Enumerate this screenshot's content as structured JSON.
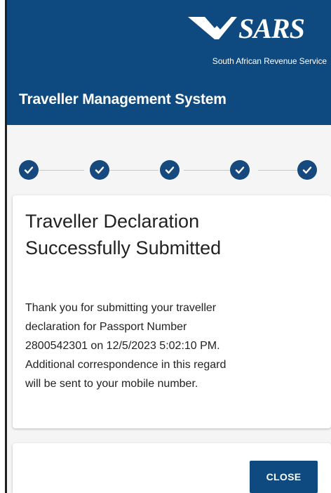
{
  "brand": {
    "logo_text": "SARS",
    "subtitle": "South African Revenue Service"
  },
  "app": {
    "title": "Traveller Management System"
  },
  "stepper": {
    "steps": [
      {
        "status": "completed",
        "icon": "check-icon"
      },
      {
        "status": "completed",
        "icon": "check-icon"
      },
      {
        "status": "completed",
        "icon": "check-icon"
      },
      {
        "status": "completed",
        "icon": "check-icon"
      },
      {
        "status": "completed",
        "icon": "check-icon"
      }
    ]
  },
  "card": {
    "title_line1": "Traveller Declaration",
    "title_line2": "Successfully Submitted",
    "message_lines": [
      "Thank you for submitting your traveller",
      "declaration for Passport Number",
      "2800542301 on 12/5/2023 5:02:10 PM.",
      "Additional correspondence in this regard",
      "will be sent to your mobile number."
    ]
  },
  "actions": {
    "close_label": "CLOSE"
  },
  "colors": {
    "primary": "#0e4a7f",
    "step_completed": "#164a7e",
    "background": "#f5f5f5"
  }
}
